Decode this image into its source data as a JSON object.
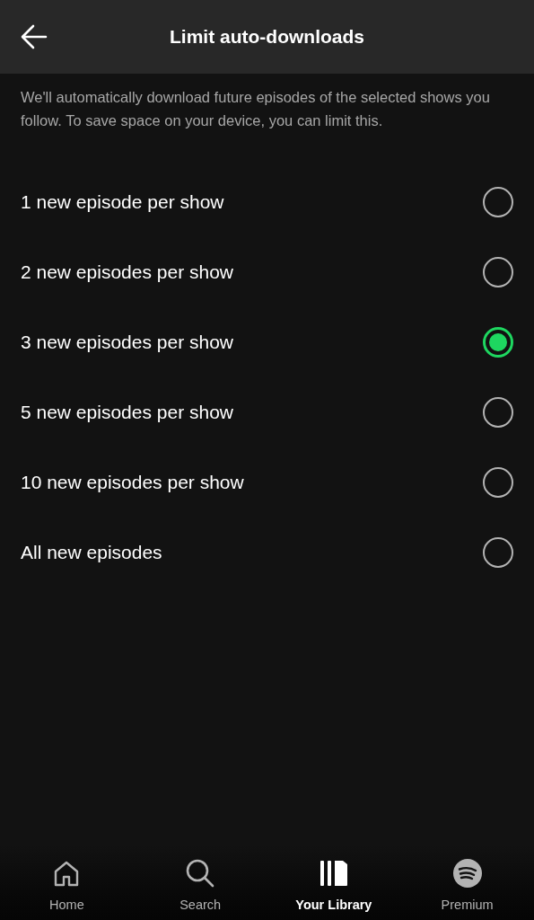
{
  "header": {
    "title": "Limit auto-downloads"
  },
  "description": "We'll automatically download future episodes of the selected shows you follow. To save space on your device, you can limit this.",
  "options": [
    {
      "label": "1 new episode per show",
      "selected": false
    },
    {
      "label": "2 new episodes per show",
      "selected": false
    },
    {
      "label": "3 new episodes per show",
      "selected": true
    },
    {
      "label": "5 new episodes per show",
      "selected": false
    },
    {
      "label": "10 new episodes per show",
      "selected": false
    },
    {
      "label": "All new episodes",
      "selected": false
    }
  ],
  "nav": [
    {
      "kind": "home",
      "label": "Home",
      "selected": false
    },
    {
      "kind": "search",
      "label": "Search",
      "selected": false
    },
    {
      "kind": "library",
      "label": "Your Library",
      "selected": true
    },
    {
      "kind": "premium",
      "label": "Premium",
      "selected": false
    }
  ]
}
